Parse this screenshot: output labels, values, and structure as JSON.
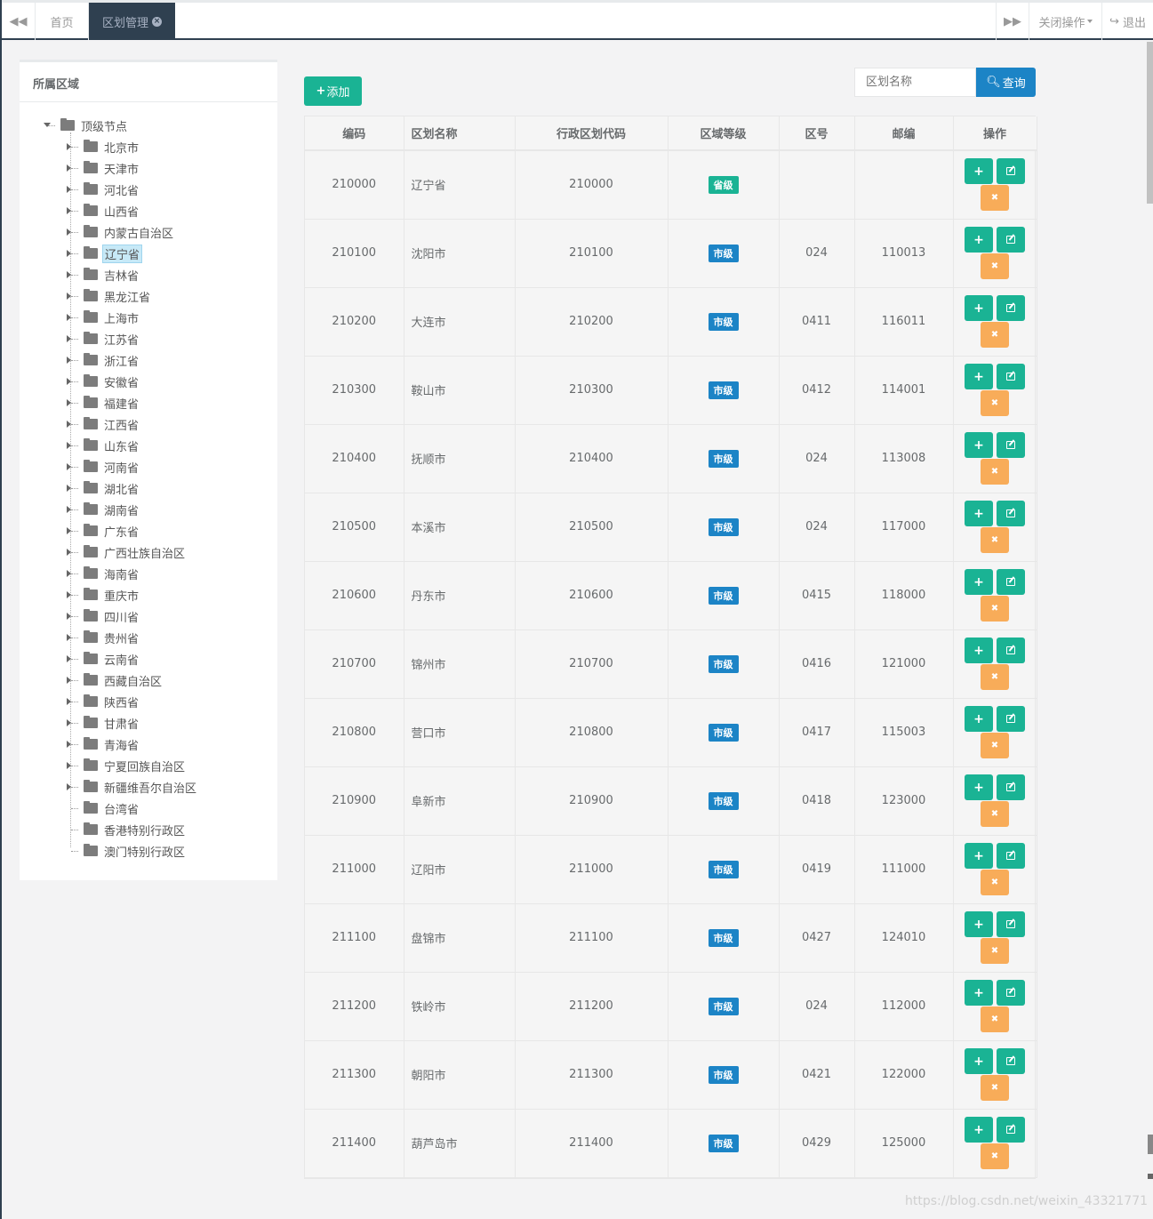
{
  "topbar": {
    "home_tab": "首页",
    "active_tab": "区划管理",
    "close_ops": "关闭操作",
    "logout": "退出"
  },
  "tree": {
    "title": "所属区域",
    "root": "顶级节点",
    "nodes": [
      {
        "label": "北京市"
      },
      {
        "label": "天津市"
      },
      {
        "label": "河北省"
      },
      {
        "label": "山西省"
      },
      {
        "label": "内蒙古自治区"
      },
      {
        "label": "辽宁省",
        "selected": true
      },
      {
        "label": "吉林省"
      },
      {
        "label": "黑龙江省"
      },
      {
        "label": "上海市"
      },
      {
        "label": "江苏省"
      },
      {
        "label": "浙江省"
      },
      {
        "label": "安徽省"
      },
      {
        "label": "福建省"
      },
      {
        "label": "江西省"
      },
      {
        "label": "山东省"
      },
      {
        "label": "河南省"
      },
      {
        "label": "湖北省"
      },
      {
        "label": "湖南省"
      },
      {
        "label": "广东省"
      },
      {
        "label": "广西壮族自治区"
      },
      {
        "label": "海南省"
      },
      {
        "label": "重庆市"
      },
      {
        "label": "四川省"
      },
      {
        "label": "贵州省"
      },
      {
        "label": "云南省"
      },
      {
        "label": "西藏自治区"
      },
      {
        "label": "陕西省"
      },
      {
        "label": "甘肃省"
      },
      {
        "label": "青海省"
      },
      {
        "label": "宁夏回族自治区"
      },
      {
        "label": "新疆维吾尔自治区"
      },
      {
        "label": "台湾省",
        "leaf": true
      },
      {
        "label": "香港特别行政区",
        "leaf": true
      },
      {
        "label": "澳门特别行政区",
        "leaf": true
      }
    ]
  },
  "toolbar": {
    "add_label": "添加",
    "search_placeholder": "区划名称",
    "search_label": "查询"
  },
  "table": {
    "headers": [
      "编码",
      "区划名称",
      "行政区划代码",
      "区域等级",
      "区号",
      "邮编",
      "操作"
    ],
    "rows": [
      {
        "code": "210000",
        "name": "辽宁省",
        "admin_code": "210000",
        "level": "省级",
        "level_type": "prov",
        "area_code": "",
        "postcode": ""
      },
      {
        "code": "210100",
        "name": "沈阳市",
        "admin_code": "210100",
        "level": "市级",
        "level_type": "city",
        "area_code": "024",
        "postcode": "110013"
      },
      {
        "code": "210200",
        "name": "大连市",
        "admin_code": "210200",
        "level": "市级",
        "level_type": "city",
        "area_code": "0411",
        "postcode": "116011"
      },
      {
        "code": "210300",
        "name": "鞍山市",
        "admin_code": "210300",
        "level": "市级",
        "level_type": "city",
        "area_code": "0412",
        "postcode": "114001"
      },
      {
        "code": "210400",
        "name": "抚顺市",
        "admin_code": "210400",
        "level": "市级",
        "level_type": "city",
        "area_code": "024",
        "postcode": "113008"
      },
      {
        "code": "210500",
        "name": "本溪市",
        "admin_code": "210500",
        "level": "市级",
        "level_type": "city",
        "area_code": "024",
        "postcode": "117000"
      },
      {
        "code": "210600",
        "name": "丹东市",
        "admin_code": "210600",
        "level": "市级",
        "level_type": "city",
        "area_code": "0415",
        "postcode": "118000"
      },
      {
        "code": "210700",
        "name": "锦州市",
        "admin_code": "210700",
        "level": "市级",
        "level_type": "city",
        "area_code": "0416",
        "postcode": "121000"
      },
      {
        "code": "210800",
        "name": "营口市",
        "admin_code": "210800",
        "level": "市级",
        "level_type": "city",
        "area_code": "0417",
        "postcode": "115003"
      },
      {
        "code": "210900",
        "name": "阜新市",
        "admin_code": "210900",
        "level": "市级",
        "level_type": "city",
        "area_code": "0418",
        "postcode": "123000"
      },
      {
        "code": "211000",
        "name": "辽阳市",
        "admin_code": "211000",
        "level": "市级",
        "level_type": "city",
        "area_code": "0419",
        "postcode": "111000"
      },
      {
        "code": "211100",
        "name": "盘锦市",
        "admin_code": "211100",
        "level": "市级",
        "level_type": "city",
        "area_code": "0427",
        "postcode": "124010"
      },
      {
        "code": "211200",
        "name": "铁岭市",
        "admin_code": "211200",
        "level": "市级",
        "level_type": "city",
        "area_code": "024",
        "postcode": "112000"
      },
      {
        "code": "211300",
        "name": "朝阳市",
        "admin_code": "211300",
        "level": "市级",
        "level_type": "city",
        "area_code": "0421",
        "postcode": "122000"
      },
      {
        "code": "211400",
        "name": "葫芦岛市",
        "admin_code": "211400",
        "level": "市级",
        "level_type": "city",
        "area_code": "0429",
        "postcode": "125000"
      }
    ]
  },
  "watermark": "https://blog.csdn.net/weixin_43321771",
  "colors": {
    "nav_dark": "#2f4050",
    "primary_green": "#1ab394",
    "info_blue": "#1c84c6",
    "warning_orange": "#f8ac59"
  }
}
